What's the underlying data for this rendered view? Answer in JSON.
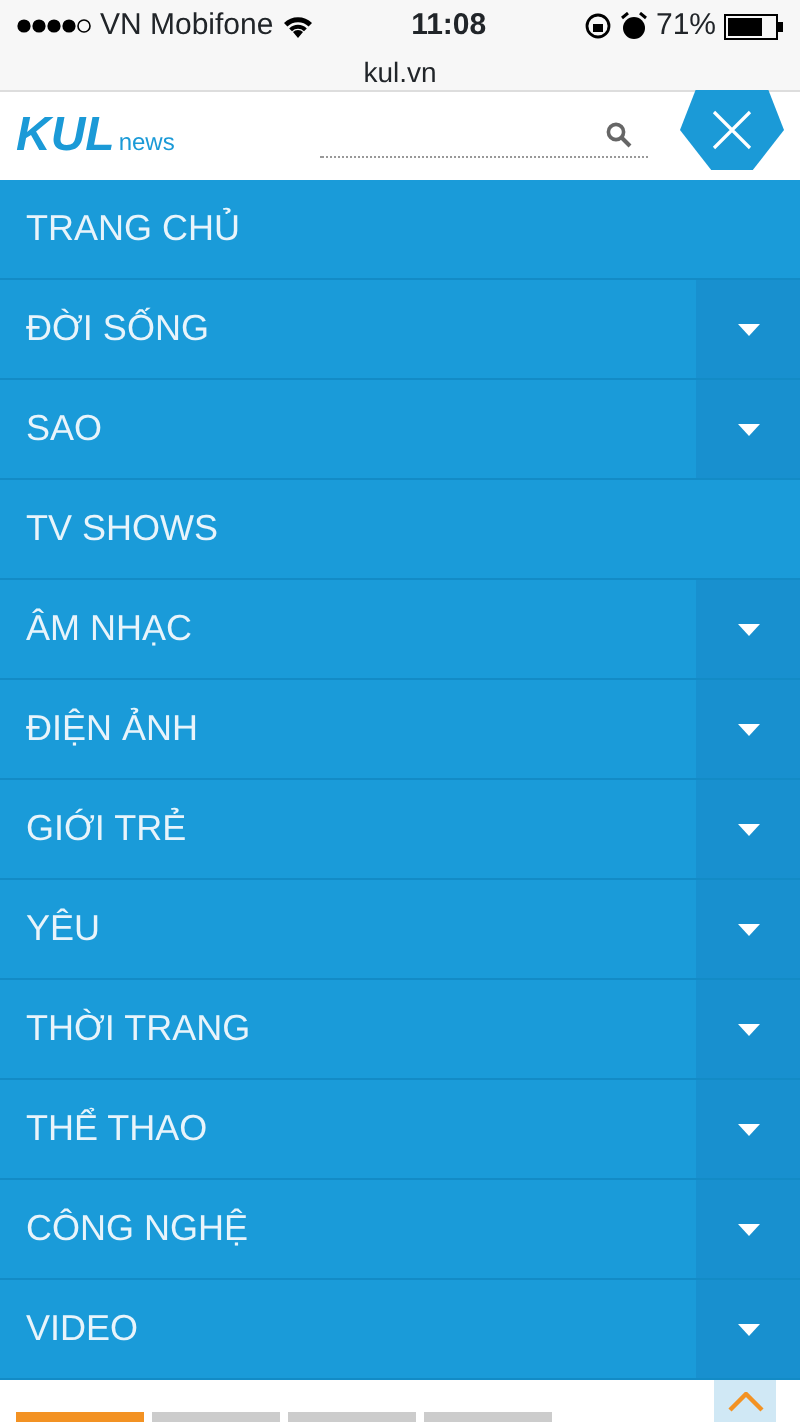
{
  "status_bar": {
    "carrier": "VN Mobifone",
    "time": "11:08",
    "battery": "71%"
  },
  "url": "kul.vn",
  "header": {
    "logo_text": "KUL",
    "logo_sub": "news"
  },
  "menu": [
    {
      "label": "TRANG CHỦ",
      "has_submenu": false
    },
    {
      "label": "ĐỜI SỐNG",
      "has_submenu": true
    },
    {
      "label": "SAO",
      "has_submenu": true
    },
    {
      "label": "TV SHOWS",
      "has_submenu": false
    },
    {
      "label": "ÂM NHẠC",
      "has_submenu": true
    },
    {
      "label": "ĐIỆN ẢNH",
      "has_submenu": true
    },
    {
      "label": "GIỚI TRẺ",
      "has_submenu": true
    },
    {
      "label": "YÊU",
      "has_submenu": true
    },
    {
      "label": "THỜI TRANG",
      "has_submenu": true
    },
    {
      "label": "THỂ THAO",
      "has_submenu": true
    },
    {
      "label": "CÔNG NGHỆ",
      "has_submenu": true
    },
    {
      "label": "VIDEO",
      "has_submenu": true
    }
  ],
  "bottom_tabs": [
    {
      "selected": true
    },
    {
      "selected": false
    },
    {
      "selected": false
    },
    {
      "selected": false
    }
  ]
}
